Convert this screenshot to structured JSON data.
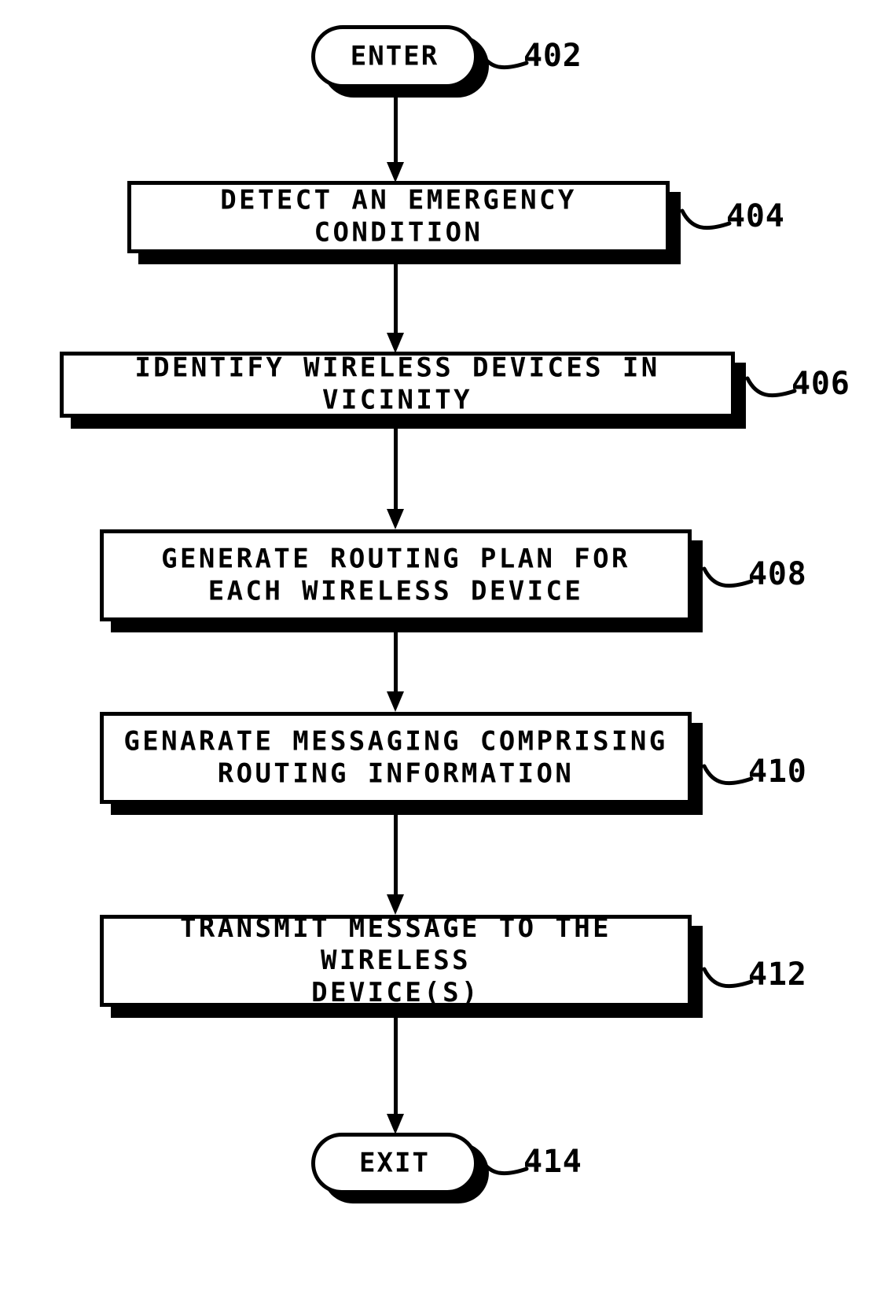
{
  "figure": {
    "type": "patent-flowchart",
    "background_color": "#ffffff",
    "line_color": "#000000"
  },
  "nodes": [
    {
      "id": "enter",
      "shape": "terminator",
      "label": "ENTER",
      "ref": "402"
    },
    {
      "id": "step-404",
      "shape": "process",
      "label": "DETECT AN EMERGENCY CONDITION",
      "ref": "404"
    },
    {
      "id": "step-406",
      "shape": "process",
      "label": "IDENTIFY WIRELESS DEVICES IN VICINITY",
      "ref": "406"
    },
    {
      "id": "step-408",
      "shape": "process",
      "label": "GENERATE ROUTING PLAN FOR\nEACH WIRELESS DEVICE",
      "ref": "408"
    },
    {
      "id": "step-410",
      "shape": "process",
      "label": "GENARATE MESSAGING COMPRISING\nROUTING INFORMATION",
      "ref": "410"
    },
    {
      "id": "step-412",
      "shape": "process",
      "label": "TRANSMIT MESSAGE TO THE WIRELESS\nDEVICE(S)",
      "ref": "412"
    },
    {
      "id": "exit",
      "shape": "terminator",
      "label": "EXIT",
      "ref": "414"
    }
  ],
  "connectors": [
    {
      "from": "enter",
      "to": "step-404",
      "arrowhead": "down"
    },
    {
      "from": "step-404",
      "to": "step-406",
      "arrowhead": "down"
    },
    {
      "from": "step-406",
      "to": "step-408",
      "arrowhead": "down"
    },
    {
      "from": "step-408",
      "to": "step-410",
      "arrowhead": "down"
    },
    {
      "from": "step-410",
      "to": "step-412",
      "arrowhead": "down"
    },
    {
      "from": "step-412",
      "to": "exit",
      "arrowhead": "down"
    }
  ]
}
